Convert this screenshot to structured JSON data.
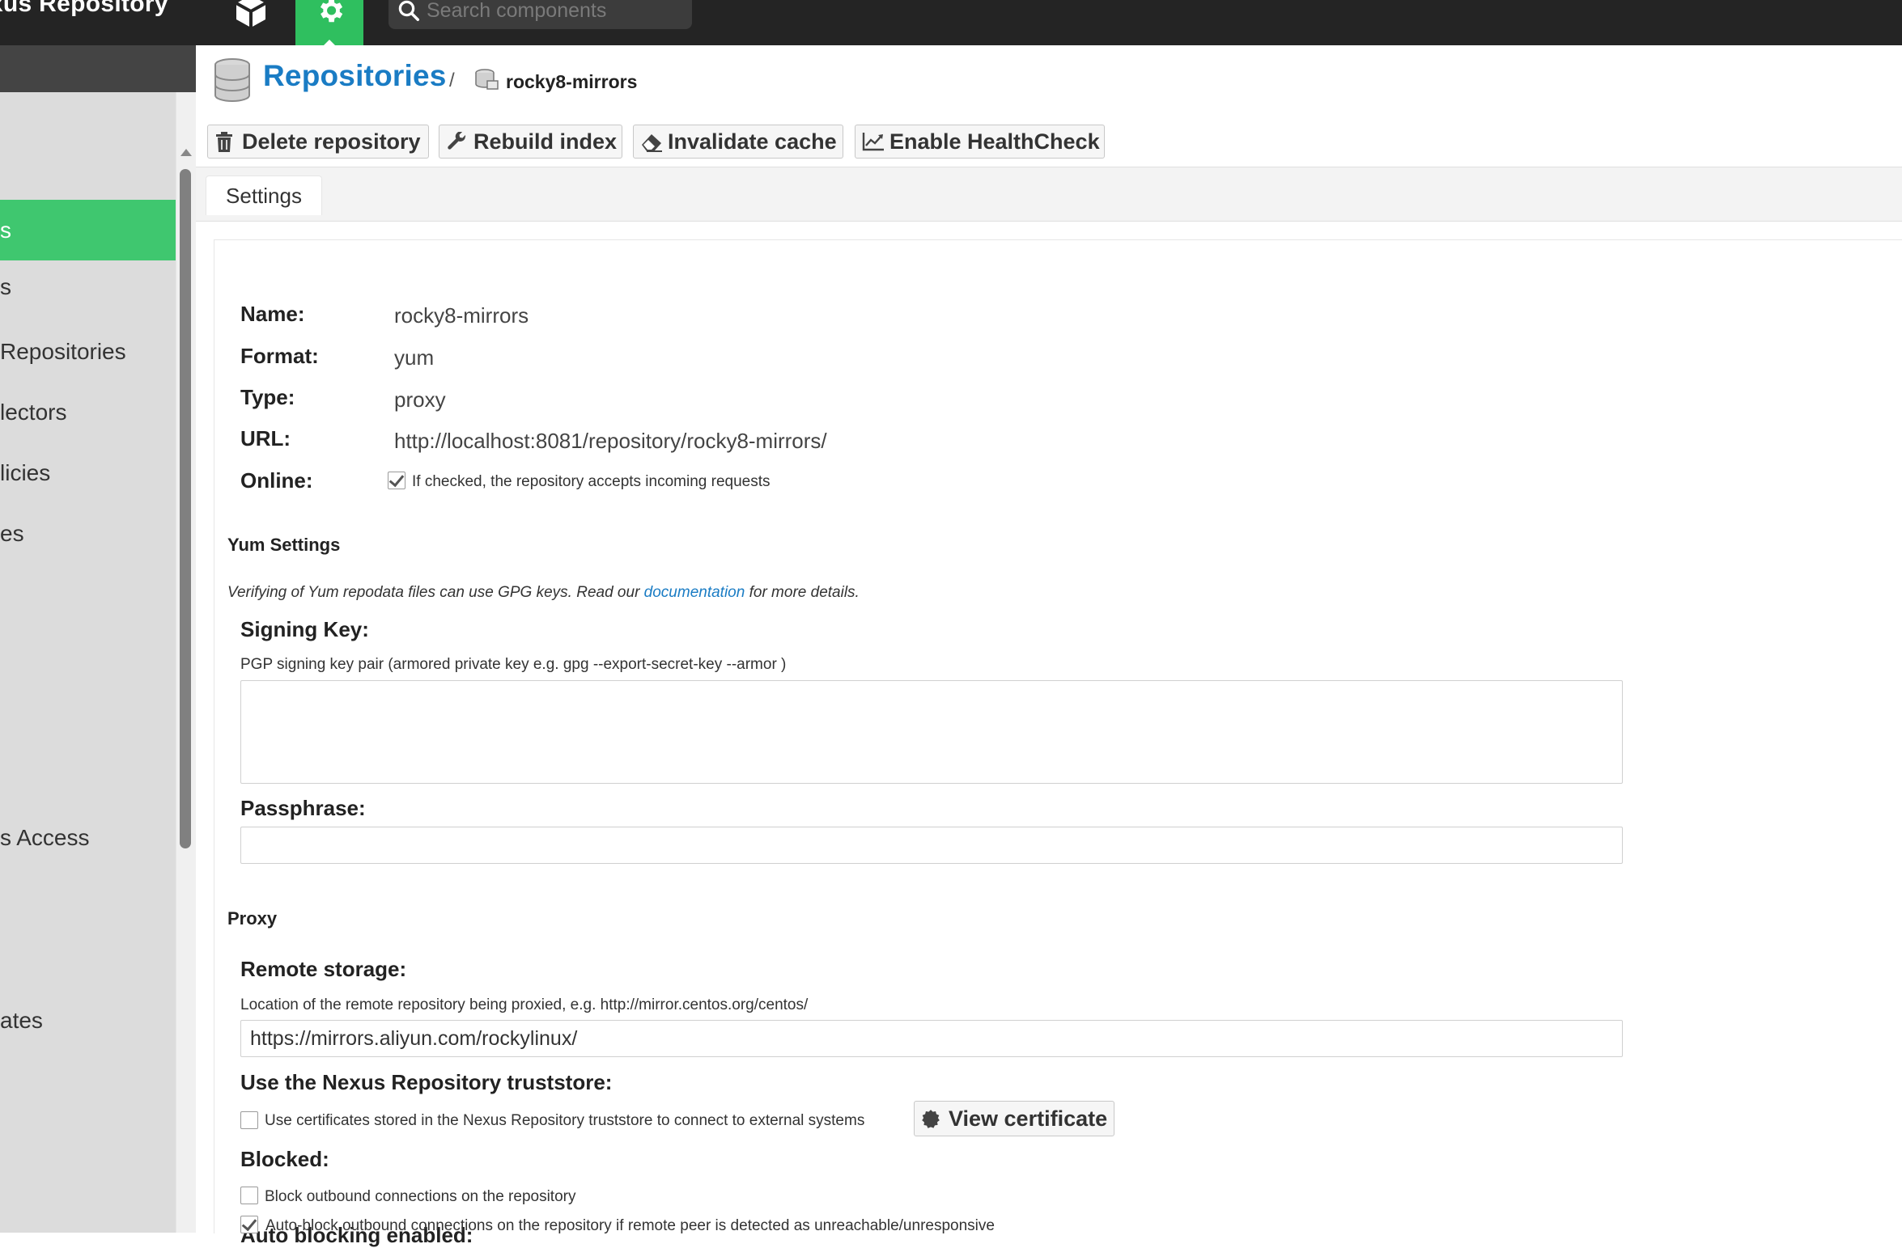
{
  "topbar": {
    "brand": "Nexus Repository",
    "search_placeholder": "Search components"
  },
  "sidebar": {
    "items": [
      {
        "label": "s",
        "active": true
      },
      {
        "label": "s",
        "active": false
      },
      {
        "label": " Repositories",
        "active": false
      },
      {
        "label": "lectors",
        "active": false
      },
      {
        "label": "licies",
        "active": false
      },
      {
        "label": "es",
        "active": false
      },
      {
        "label": "s Access",
        "active": false
      },
      {
        "label": "ates",
        "active": false
      }
    ]
  },
  "breadcrumb": {
    "title": "Repositories",
    "separator": "/",
    "current": "rocky8-mirrors"
  },
  "toolbar": {
    "delete_label": "Delete repository",
    "rebuild_label": "Rebuild index",
    "invalidate_label": "Invalidate cache",
    "healthcheck_label": "Enable HealthCheck"
  },
  "tabs": {
    "settings": "Settings"
  },
  "form": {
    "name_label": "Name:",
    "name_value": "rocky8-mirrors",
    "format_label": "Format:",
    "format_value": "yum",
    "type_label": "Type:",
    "type_value": "proxy",
    "url_label": "URL:",
    "url_value": "http://localhost:8081/repository/rocky8-mirrors/",
    "online_label": "Online:",
    "online_help": "If checked, the repository accepts incoming requests",
    "online_checked": true,
    "yum_section": "Yum Settings",
    "yum_help_pre": "Verifying of Yum repodata files can use GPG keys. Read our ",
    "yum_help_link": "documentation",
    "yum_help_post": " for more details.",
    "signing_label": "Signing Key:",
    "signing_help": "PGP signing key pair (armored private key e.g. gpg --export-secret-key --armor )",
    "passphrase_label": "Passphrase:",
    "proxy_section": "Proxy",
    "remote_label": "Remote storage:",
    "remote_help": "Location of the remote repository being proxied, e.g. http://mirror.centos.org/centos/",
    "remote_value": "https://mirrors.aliyun.com/rockylinux/",
    "truststore_label": "Use the Nexus Repository truststore:",
    "truststore_help": "Use certificates stored in the Nexus Repository truststore to connect to external systems",
    "truststore_checked": false,
    "view_cert_label": "View certificate",
    "blocked_label": "Blocked:",
    "blocked_help": "Block outbound connections on the repository",
    "blocked_checked": false,
    "autoblock_label": "Auto blocking enabled:",
    "autoblock_help": "Auto-block outbound connections on the repository if remote peer is detected as unreachable/unresponsive",
    "autoblock_checked": true
  },
  "colors": {
    "accent_green": "#3fc76f",
    "link_blue": "#1a7cc4",
    "topbar": "#242424"
  }
}
